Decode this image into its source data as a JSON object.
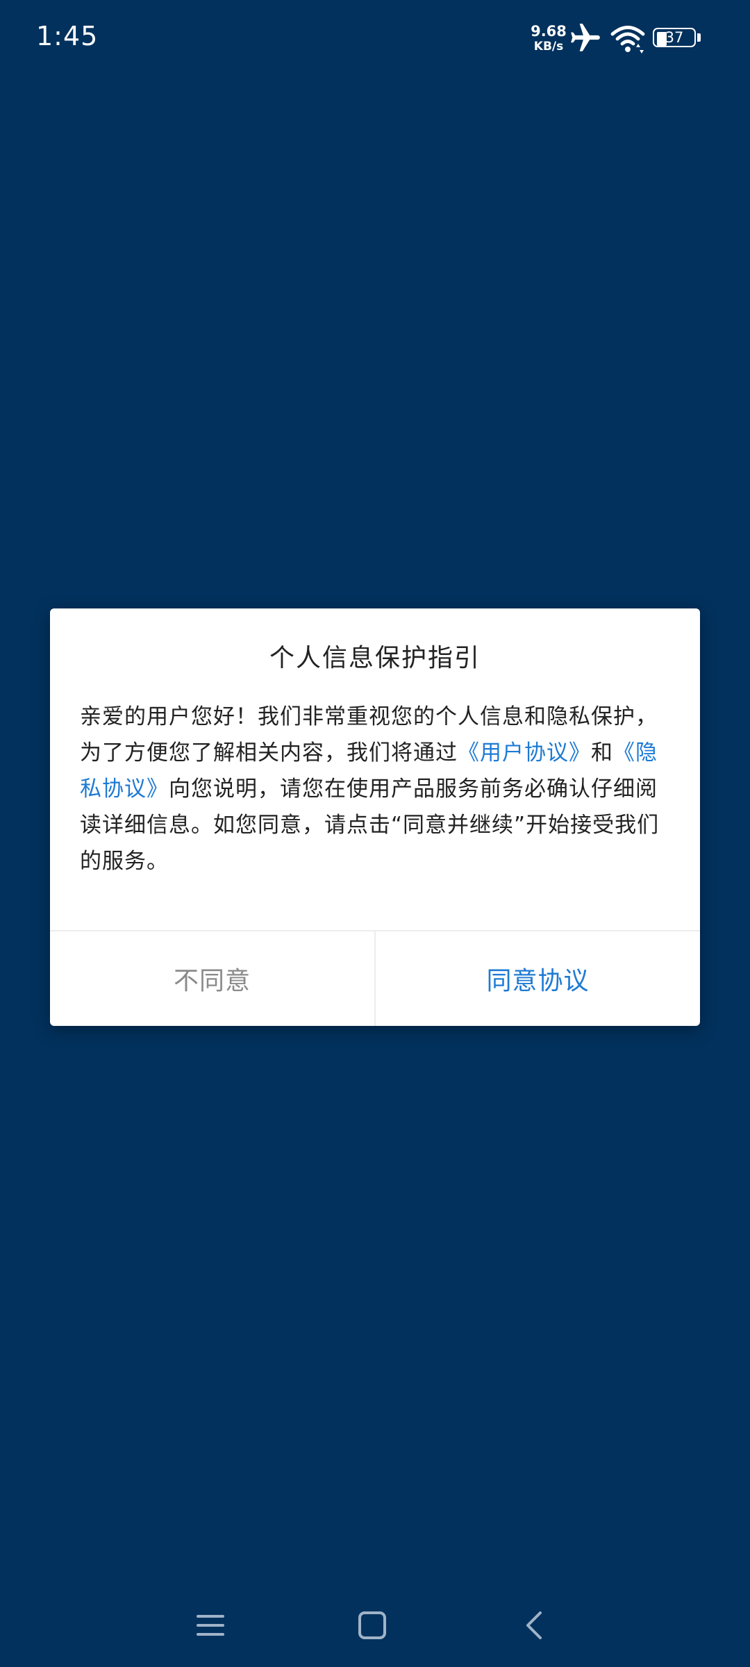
{
  "status_bar": {
    "time": "1:45",
    "net_speed_value": "9.68",
    "net_speed_unit": "KB/s",
    "battery_level": "37",
    "icons": [
      "airplane-icon",
      "wifi-icon",
      "battery-icon"
    ]
  },
  "dialog": {
    "title": "个人信息保护指引",
    "body": {
      "part1": "亲爱的用户您好！我们非常重视您的个人信息和隐私保护，为了方便您了解相关内容，我们将通过",
      "user_agreement_link": "《用户协议》",
      "part2": "和",
      "privacy_agreement_link": "《隐私协议》",
      "part3": "向您说明，请您在使用产品服务前务必确认仔细阅读详细信息。如您同意，请点击“同意并继续”开始接受我们的服务。"
    },
    "disagree_label": "不同意",
    "agree_label": "同意协议"
  },
  "nav_bar": {
    "icons": [
      "menu-icon",
      "home-icon",
      "back-icon"
    ]
  },
  "colors": {
    "background": "#02315d",
    "link": "#1e7ad4",
    "disagree_text": "#8a8a8a",
    "dialog_bg": "#ffffff"
  }
}
